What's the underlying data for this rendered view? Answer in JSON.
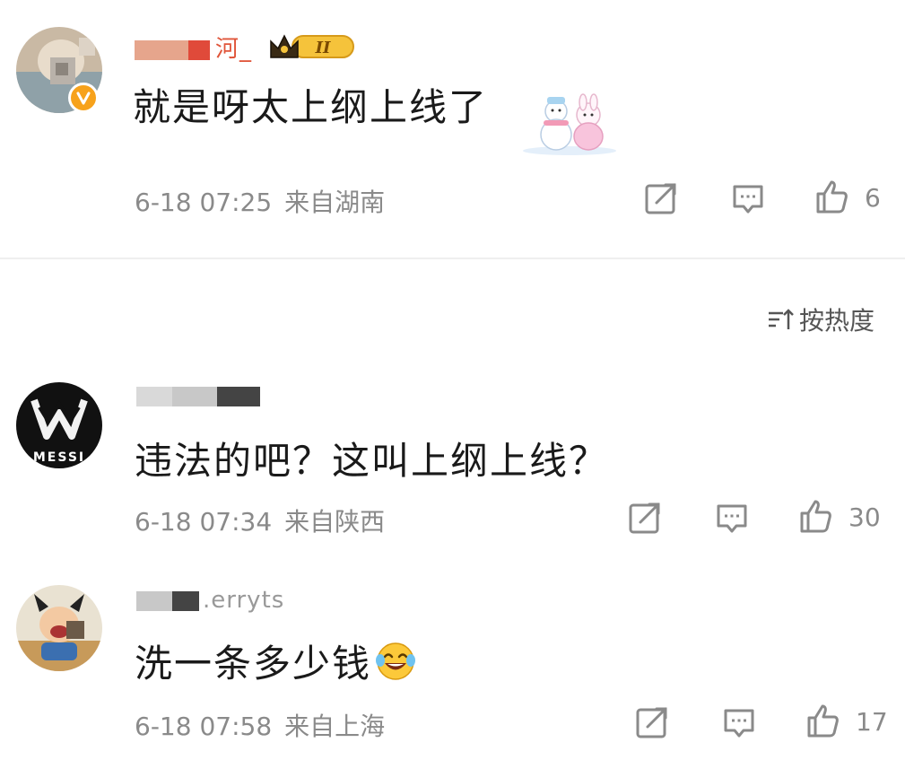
{
  "comments": [
    {
      "username_visible": "河_",
      "text": "就是呀太上纲上线了",
      "date": "6-18 07:25",
      "location": "来自湖南",
      "likes": "6",
      "badge_level": "II",
      "has_verified_badge": true,
      "has_sticker": true
    },
    {
      "username_visible": "",
      "text": "违法的吧？这叫上纲上线？",
      "date": "6-18 07:34",
      "location": "来自陕西",
      "likes": "30",
      "avatar_text": "MESSI"
    },
    {
      "username_visible": ".erryts",
      "text": "洗一条多少钱",
      "date": "6-18 07:58",
      "location": "来自上海",
      "likes": "17",
      "trailing_emoji": "laughing-tears"
    }
  ],
  "sort": {
    "label": "按热度"
  },
  "icons": {
    "share": "share-icon",
    "comment": "comment-icon",
    "like": "thumbs-up-icon",
    "sort": "sort-icon"
  },
  "colors": {
    "text_primary": "#1a1a1a",
    "text_meta": "#8a8a8a",
    "verified": "#f7a21b",
    "badge_gold": "#f5c33b",
    "divider": "#efefef"
  }
}
